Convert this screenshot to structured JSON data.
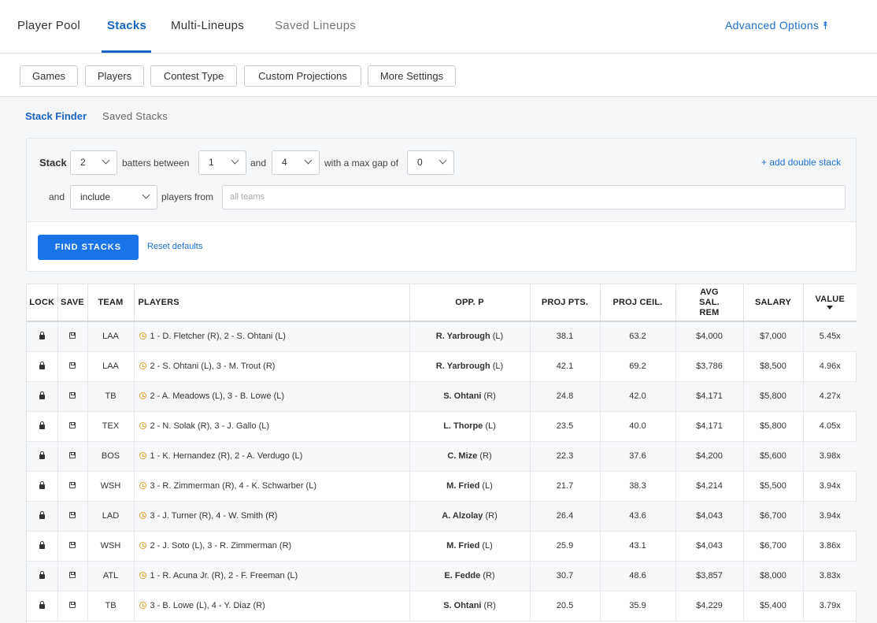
{
  "topnav": {
    "tabs": [
      {
        "label": "Player Pool"
      },
      {
        "label": "Stacks"
      },
      {
        "label": "Multi-Lineups"
      },
      {
        "label": "Saved Lineups"
      }
    ],
    "advanced_options": "Advanced Options ⯭"
  },
  "settings": {
    "buttons": [
      "Games",
      "Players",
      "Contest Type",
      "Custom Projections",
      "More Settings"
    ]
  },
  "subtabs": {
    "active": "Stack Finder",
    "other": "Saved Stacks"
  },
  "stack": {
    "label": "Stack",
    "count": "2",
    "between_label": "batters between",
    "from": "1",
    "and_label": "and",
    "to": "4",
    "gap_label": "with a max gap of",
    "gap": "0",
    "add_double": "+ add double stack",
    "and2_label": "and",
    "mode": "include",
    "players_from_label": "players from",
    "teams_placeholder": "all teams",
    "find_button": "FIND STACKS",
    "reset": "Reset defaults"
  },
  "table": {
    "headers": [
      "LOCK",
      "SAVE",
      "TEAM",
      "PLAYERS",
      "OPP. P",
      "PROJ PTS.",
      "PROJ CEIL.",
      "AVG SAL. REM",
      "SALARY",
      "VALUE"
    ],
    "rows": [
      {
        "team": "LAA",
        "players": "1 - D. Fletcher (R), 2 - S. Ohtani (L)",
        "opp": "R. Yarbrough",
        "opp_hand": "(L)",
        "pts": "38.1",
        "ceil": "63.2",
        "avg": "$4,000",
        "salary": "$7,000",
        "value": "5.45x"
      },
      {
        "team": "LAA",
        "players": "2 - S. Ohtani (L), 3 - M. Trout (R)",
        "opp": "R. Yarbrough",
        "opp_hand": "(L)",
        "pts": "42.1",
        "ceil": "69.2",
        "avg": "$3,786",
        "salary": "$8,500",
        "value": "4.96x"
      },
      {
        "team": "TB",
        "players": "2 - A. Meadows (L), 3 - B. Lowe (L)",
        "opp": "S. Ohtani",
        "opp_hand": "(R)",
        "pts": "24.8",
        "ceil": "42.0",
        "avg": "$4,171",
        "salary": "$5,800",
        "value": "4.27x"
      },
      {
        "team": "TEX",
        "players": "2 - N. Solak (R), 3 - J. Gallo (L)",
        "opp": "L. Thorpe",
        "opp_hand": "(L)",
        "pts": "23.5",
        "ceil": "40.0",
        "avg": "$4,171",
        "salary": "$5,800",
        "value": "4.05x"
      },
      {
        "team": "BOS",
        "players": "1 - K. Hernandez (R), 2 - A. Verdugo (L)",
        "opp": "C. Mize",
        "opp_hand": "(R)",
        "pts": "22.3",
        "ceil": "37.6",
        "avg": "$4,200",
        "salary": "$5,600",
        "value": "3.98x"
      },
      {
        "team": "WSH",
        "players": "3 - R. Zimmerman (R), 4 - K. Schwarber (L)",
        "opp": "M. Fried",
        "opp_hand": "(L)",
        "pts": "21.7",
        "ceil": "38.3",
        "avg": "$4,214",
        "salary": "$5,500",
        "value": "3.94x"
      },
      {
        "team": "LAD",
        "players": "3 - J. Turner (R), 4 - W. Smith (R)",
        "opp": "A. Alzolay",
        "opp_hand": "(R)",
        "pts": "26.4",
        "ceil": "43.6",
        "avg": "$4,043",
        "salary": "$6,700",
        "value": "3.94x"
      },
      {
        "team": "WSH",
        "players": "2 - J. Soto (L), 3 - R. Zimmerman (R)",
        "opp": "M. Fried",
        "opp_hand": "(L)",
        "pts": "25.9",
        "ceil": "43.1",
        "avg": "$4,043",
        "salary": "$6,700",
        "value": "3.86x"
      },
      {
        "team": "ATL",
        "players": "1 - R. Acuna Jr. (R), 2 - F. Freeman (L)",
        "opp": "E. Fedde",
        "opp_hand": "(R)",
        "pts": "30.7",
        "ceil": "48.6",
        "avg": "$3,857",
        "salary": "$8,000",
        "value": "3.83x"
      },
      {
        "team": "TB",
        "players": "3 - B. Lowe (L), 4 - Y. Diaz (R)",
        "opp": "S. Ohtani",
        "opp_hand": "(R)",
        "pts": "20.5",
        "ceil": "35.9",
        "avg": "$4,229",
        "salary": "$5,400",
        "value": "3.79x"
      }
    ]
  },
  "colors": {
    "accent": "#1565c0",
    "button_blue": "#1a73e8",
    "clock": "#e0a030"
  },
  "icons": [
    "lock-icon",
    "save-icon",
    "clock-icon",
    "chevron-down-icon",
    "sort-desc-icon",
    "double-chevron-up-icon"
  ]
}
